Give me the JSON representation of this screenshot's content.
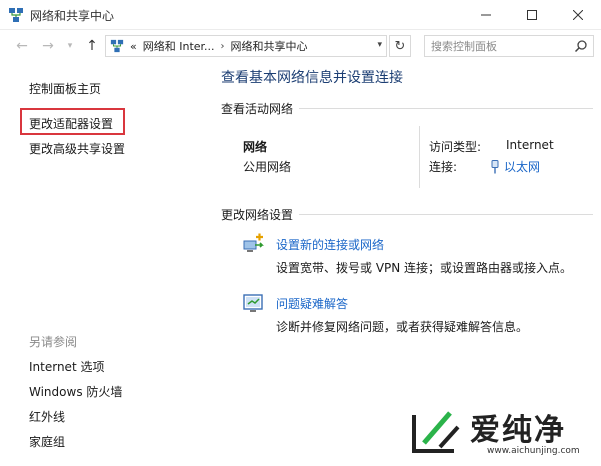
{
  "window": {
    "title": "网络和共享中心"
  },
  "address": {
    "prefix": "«",
    "segment_1": "网络和 Inter...",
    "segment_2": "网络和共享中心",
    "search_placeholder": "搜索控制面板"
  },
  "sidebar": {
    "items": [
      {
        "label": "控制面板主页"
      },
      {
        "label": "更改适配器设置",
        "highlighted": true
      },
      {
        "label": "更改高级共享设置"
      }
    ],
    "see_also_label": "另请参阅",
    "see_also": [
      {
        "label": "Internet 选项"
      },
      {
        "label": "Windows 防火墙"
      },
      {
        "label": "红外线"
      },
      {
        "label": "家庭组"
      }
    ]
  },
  "main": {
    "title": "查看基本网络信息并设置连接",
    "active_network": {
      "section_label": "查看活动网络",
      "name": "网络",
      "category": "公用网络",
      "access_type_label": "访问类型:",
      "access_type_value": "Internet",
      "connection_label": "连接:",
      "connection_value": "以太网"
    },
    "change_settings": {
      "section_label": "更改网络设置",
      "tasks": [
        {
          "link": "设置新的连接或网络",
          "description": "设置宽带、拨号或 VPN 连接；或设置路由器或接入点。",
          "icon": "network-setup-icon"
        },
        {
          "link": "问题疑难解答",
          "description": "诊断并修复网络问题，或者获得疑难解答信息。",
          "icon": "troubleshoot-icon"
        }
      ]
    }
  },
  "watermark": {
    "brand": "爱纯净",
    "url": "www.aichunjing.com"
  },
  "colors": {
    "link": "#1a66c8",
    "title": "#1c3e73",
    "highlight_border": "#d9363e"
  }
}
